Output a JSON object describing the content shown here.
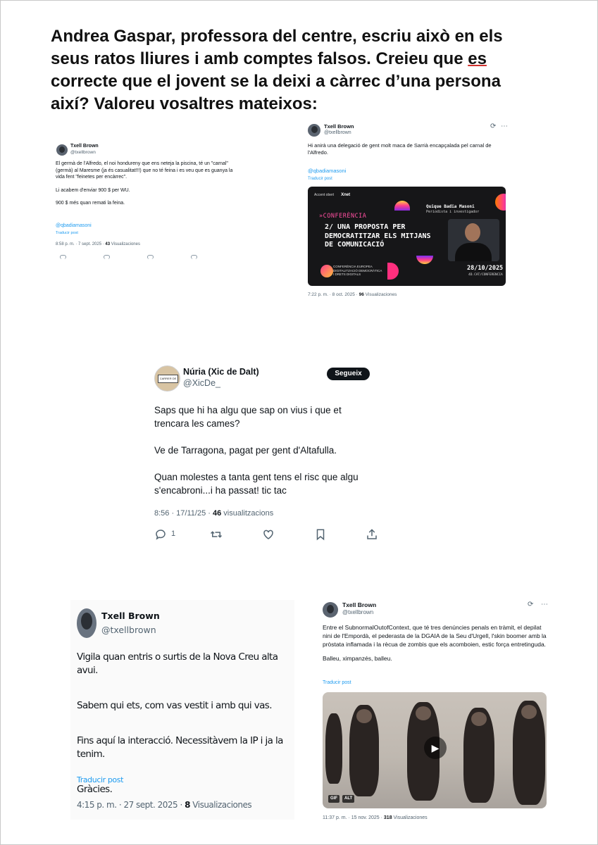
{
  "headline": {
    "part1": "Andrea Gaspar, professora del centre, escriu això en els seus ratos lliures i amb comptes falsos. Creieu que ",
    "underlined": "es",
    "part2": " correcte que el jovent se la deixi a càrrec d’una persona així? Valoreu vosaltres mateixos:"
  },
  "tweet1": {
    "name": "Txell Brown",
    "handle": "@txellbrown",
    "paragraphs": [
      "El germà de l'Alfredo, el noi hondureny que ens neteja la piscina, té un \"carnal\" (germà) al Maresme (ja és casualitat!!!) que no té feina i es veu que es guanya la vida fent \"feinetes per encàrrec\".",
      "Li acabem d'enviar 900 $ per WU.",
      "900 $ més quan remati la feina."
    ],
    "mention": "@qbadiamasoni",
    "translate": "Traducir post",
    "time": "8:58 p. m. · 7 sept. 2025 · ",
    "views_count": "43",
    "views_label": " Visualizaciones"
  },
  "tweet2": {
    "name": "Txell Brown",
    "handle": "@txellbrown",
    "text": "Hi anirà una delegació de gent molt maca de Sarrià encapçalada pel carnal de l'Alfredo.",
    "mention": "@qbadiamasoni",
    "translate": "Traducir post",
    "banner": {
      "logo1": "Accent obert",
      "logo2": "Xnet",
      "speaker": "Quique Badia Masoni",
      "role": "Periodista i investigador",
      "conference": "»CONFERÈNCIA",
      "title": "2/ UNA PROPOSTA PER DEMOCRATITZAR ELS MITJANS DE COMUNICACIÓ",
      "event": "CONFERÈNCIA EUROPEA DIGITALITZACIÓ DEMOCRÀTICA I DRETS DIGITALS",
      "date": "28/10/2025",
      "url": "4D.CAT/CONFERENCIA"
    },
    "time": "7:22 p. m. · 8 oct. 2025 · ",
    "views_count": "96",
    "views_label": " Visualizaciones"
  },
  "tweet3": {
    "name": "Núria (Xic de Dalt)",
    "handle": "@XicDe_",
    "avatar_sign": "CARRER DE DALT",
    "follow_label": "Segueix",
    "paragraphs": [
      "Saps que hi ha algu que sap on vius i que et trencara les cames?",
      "Ve de Tarragona, pagat per gent d'Altafulla.",
      "Quan molestes a tanta gent tens el risc que algu s'encabroni...i ha passat! tic tac"
    ],
    "time": "8:56 · 17/11/25 · ",
    "views_count": "46",
    "views_label": " visualitzacions",
    "reply_count": "1"
  },
  "tweet4": {
    "name": "Txell Brown",
    "handle": "@txellbrown",
    "paragraphs": [
      "Vigila quan entris o surtis de la Nova Creu alta avui.",
      "Sabem qui ets, com vas vestit i amb qui vas.",
      "Fins aquí la interacció. Necessitàvem la IP i ja la tenim.",
      "Gràcies."
    ],
    "translate": "Traducir post",
    "time": "4:15 p. m. · 27 sept. 2025 · ",
    "views_count": "8",
    "views_label": " Visualizaciones"
  },
  "tweet5": {
    "name": "Txell Brown",
    "handle": "@txellbrown",
    "paragraphs": [
      "Entre el SubnormalOutofContext, que té tres denúncies penals en tràmit, el depilat nini de l'Empordà, el pederasta de la DGAIA de la Seu d'Urgell, l'skin boomer amb la pròstata inflamada i la rècua de zombis que els acomboien, estic força entretinguda.",
      "Balleu, ximpanzés, balleu."
    ],
    "translate": "Traducir post",
    "gif_tag": "GIF",
    "alt_tag": "ALT",
    "time": "11:37 p. m. · 15 nov. 2025 · ",
    "views_count": "318",
    "views_label": " Visualizaciones"
  },
  "colors": {
    "link": "#1d9bf0",
    "text": "#0f1419",
    "muted": "#536471",
    "spellcheck": "#d0312d"
  }
}
